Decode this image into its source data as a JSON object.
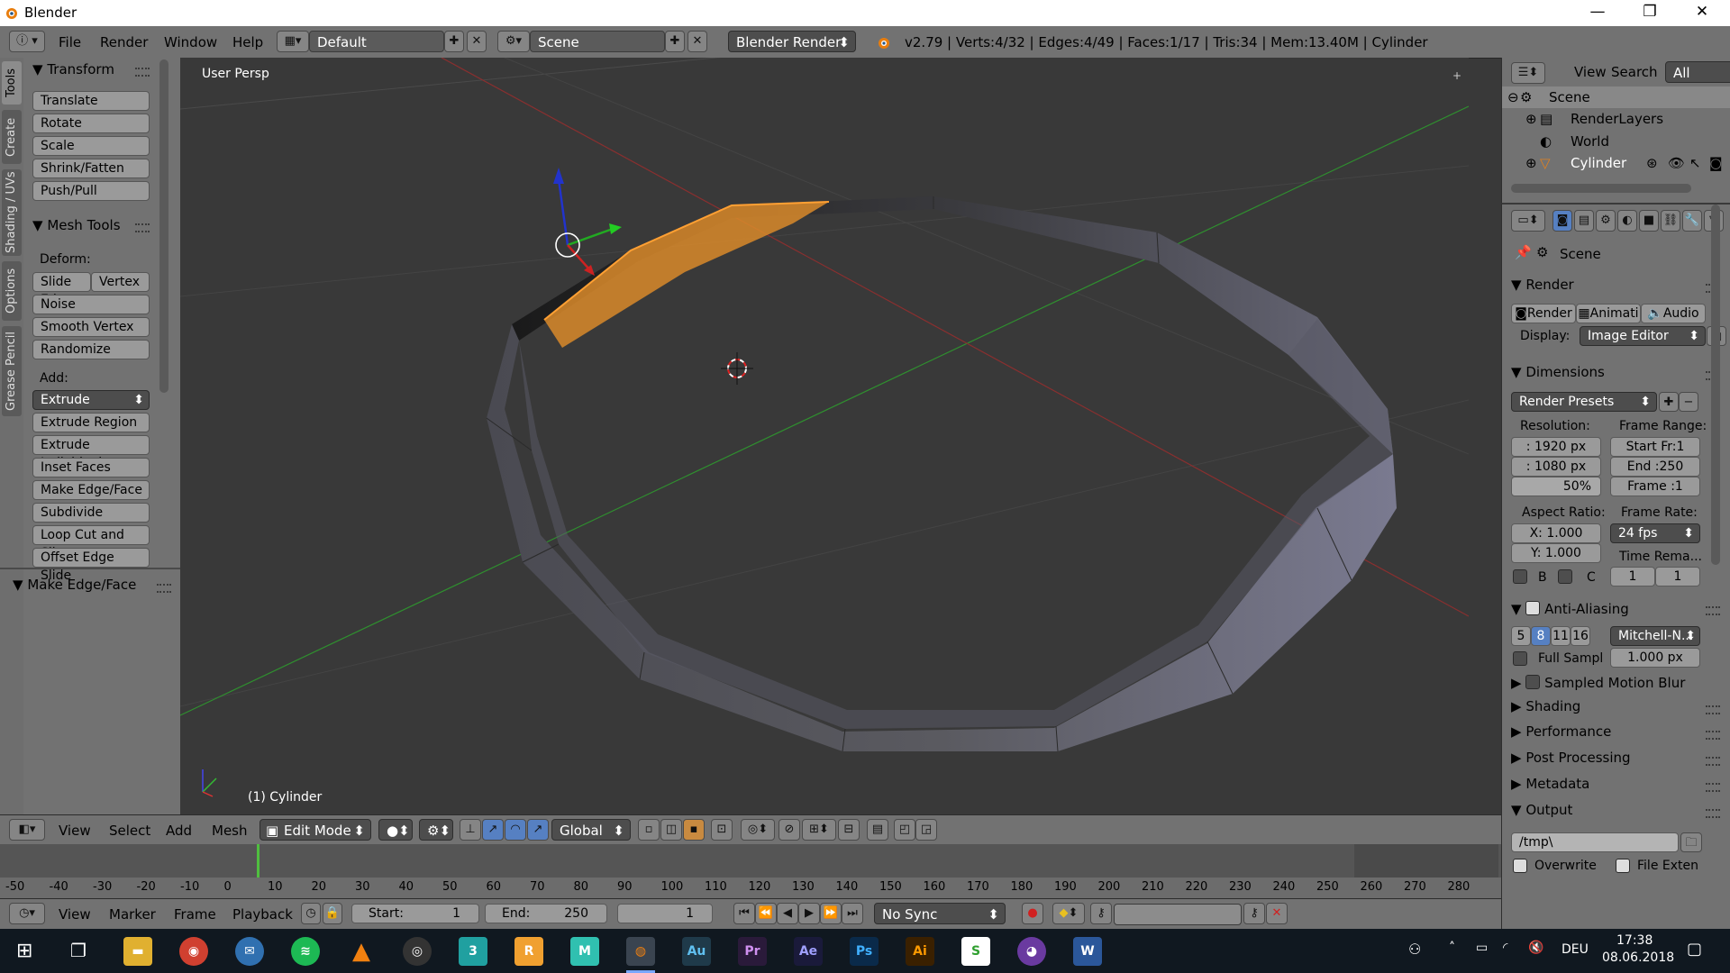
{
  "window": {
    "title": "Blender",
    "min": "—",
    "max": "❐",
    "close": "✕"
  },
  "infobar": {
    "menus": [
      "File",
      "Render",
      "Window",
      "Help"
    ],
    "layout": "Default",
    "scene": "Scene",
    "engine": "Blender Render",
    "stats": "v2.79 | Verts:4/32 | Edges:4/49 | Faces:1/17 | Tris:34 | Mem:13.40M | Cylinder"
  },
  "left_tabs": [
    "Tools",
    "Create",
    "Shading / UVs",
    "Options",
    "Grease Pencil"
  ],
  "toolshelf": {
    "transform_title": "Transform",
    "transform_buttons": [
      "Translate",
      "Rotate",
      "Scale",
      "Shrink/Fatten",
      "Push/Pull"
    ],
    "meshtools_title": "Mesh Tools",
    "deform_label": "Deform:",
    "slide_edge": "Slide Ed",
    "vertex": "Vertex",
    "deform_buttons": [
      "Noise",
      "Smooth Vertex",
      "Randomize"
    ],
    "add_label": "Add:",
    "extrude": "Extrude",
    "add_buttons": [
      "Extrude Region",
      "Extrude Individual",
      "Inset Faces",
      "Make Edge/Face",
      "Subdivide",
      "Loop Cut and Sli...",
      "Offset Edge Slide"
    ],
    "operator_title": "Make Edge/Face"
  },
  "viewport": {
    "view_name": "User Persp",
    "object_label": "(1) Cylinder"
  },
  "view_header": {
    "menus": [
      "View",
      "Select",
      "Add",
      "Mesh"
    ],
    "mode": "Edit Mode",
    "orientation": "Global"
  },
  "timeline": {
    "ticks": [
      "-50",
      "-40",
      "-30",
      "-20",
      "-10",
      "0",
      "10",
      "20",
      "30",
      "40",
      "50",
      "60",
      "70",
      "80",
      "90",
      "100",
      "110",
      "120",
      "130",
      "140",
      "150",
      "160",
      "170",
      "180",
      "190",
      "200",
      "210",
      "220",
      "230",
      "240",
      "250",
      "260",
      "270",
      "280"
    ],
    "menus": [
      "View",
      "Marker",
      "Frame",
      "Playback"
    ],
    "start_label": "Start:",
    "start_value": "1",
    "end_label": "End:",
    "end_value": "250",
    "current": "1",
    "sync": "No Sync"
  },
  "outliner": {
    "menus": [
      "View",
      "Search"
    ],
    "filter": "All Scenes",
    "items": [
      "Scene",
      "RenderLayers",
      "World",
      "Cylinder"
    ]
  },
  "properties": {
    "scene_label": "Scene",
    "render_title": "Render",
    "render_tabs": [
      "Render",
      "Animati",
      "Audio"
    ],
    "display_label": "Display:",
    "display_value": "Image Editor",
    "dimensions_title": "Dimensions",
    "presets": "Render Presets",
    "resolution_label": "Resolution:",
    "res_x": ": 1920 px",
    "res_y": ": 1080 px",
    "res_pct": "50%",
    "frame_range_label": "Frame Range:",
    "start_fr": "Start Fr:1",
    "end_fr": "End :250",
    "frame": "Frame :1",
    "aspect_label": "Aspect Ratio:",
    "aspect_x": "X:  1.000",
    "aspect_y": "Y:  1.000",
    "framerate_label": "Frame Rate:",
    "fps": "24 fps",
    "time_remap_label": "Time Rema...",
    "remap_old": "1",
    "remap_new": "1",
    "border_b": "B",
    "border_c": "C",
    "aa_title": "Anti-Aliasing",
    "aa_samples": [
      "5",
      "8",
      "11",
      "16"
    ],
    "aa_filter": "Mitchell-N...",
    "full_sample": "Full Sampl",
    "filter_size": "1.000 px",
    "collapsed": [
      "Sampled Motion Blur",
      "Shading",
      "Performance",
      "Post Processing",
      "Metadata"
    ],
    "output_title": "Output",
    "output_path": "/tmp\\",
    "overwrite": "Overwrite",
    "file_ext": "File Exten"
  },
  "taskbar": {
    "apps": [
      "Chrome",
      "Thunderbird",
      "Spotify",
      "VLC",
      "OBS",
      "3",
      "R",
      "M",
      "Blender",
      "Au",
      "Pr",
      "Ae",
      "Ps",
      "Ai",
      "S",
      "GitHub",
      "W"
    ],
    "lang": "DEU",
    "time": "17:38",
    "date": "08.06.2018"
  },
  "colors": {
    "accent_orange": "#e8891a",
    "selection": "#ffa033",
    "panel": "#727272",
    "viewport": "#393939"
  }
}
